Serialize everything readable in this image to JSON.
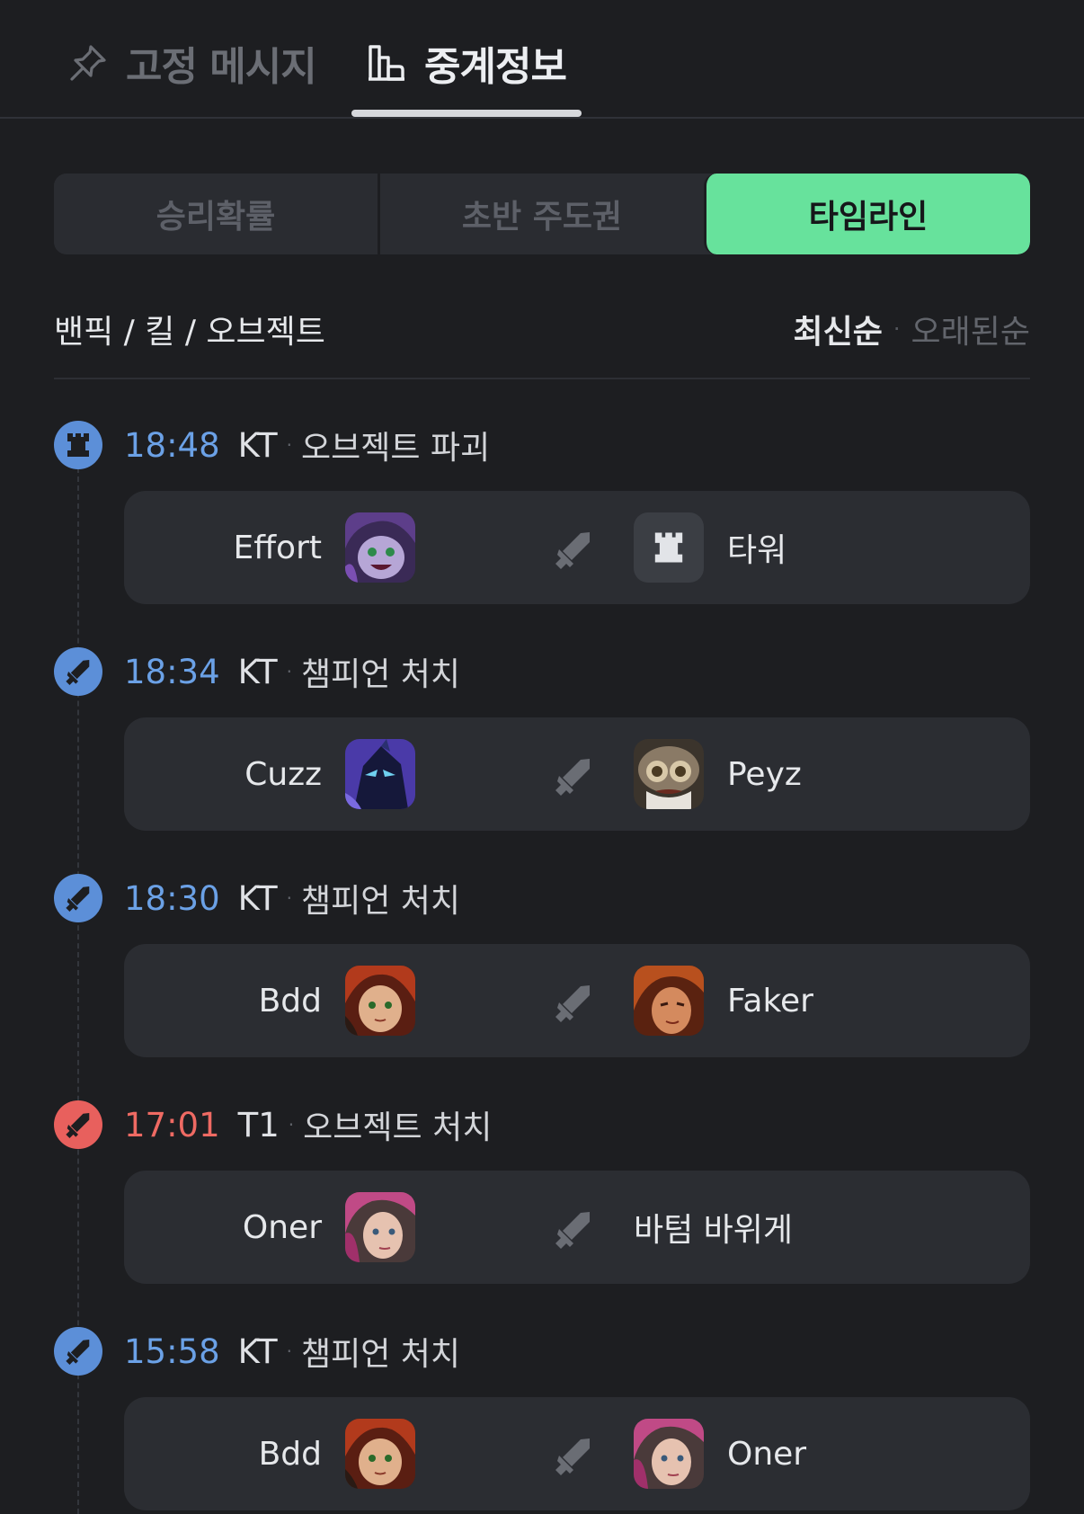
{
  "top_tabs": [
    {
      "label": "고정 메시지",
      "icon": "pin-icon",
      "active": false
    },
    {
      "label": "중계정보",
      "icon": "bar-chart-icon",
      "active": true
    }
  ],
  "segments": [
    {
      "label": "승리확률",
      "active": false
    },
    {
      "label": "초반 주도권",
      "active": false
    },
    {
      "label": "타임라인",
      "active": true
    }
  ],
  "filter": {
    "title": "밴픽 / 킬 / 오브젝트",
    "sort_active": "최신순",
    "sort_separator": "·",
    "sort_inactive": "오래된순"
  },
  "colors": {
    "accent_green": "#67e29c",
    "team_blue": "#6ba1e6",
    "team_red": "#ef6a63"
  },
  "events": [
    {
      "time": "18:48",
      "team": "KT",
      "separator": "·",
      "desc": "오브젝트 파괴",
      "team_color": "blue",
      "icon": "tower-icon",
      "left_player": "Effort",
      "left_avatar": "lulu-avatar",
      "right_label": "타워",
      "right_avatar": "tower-tile"
    },
    {
      "time": "18:34",
      "team": "KT",
      "separator": "·",
      "desc": "챔피언 처치",
      "team_color": "blue",
      "icon": "sword-icon",
      "left_player": "Cuzz",
      "left_avatar": "kayn-avatar",
      "right_label": "Peyz",
      "right_avatar": "ziggs-avatar"
    },
    {
      "time": "18:30",
      "team": "KT",
      "separator": "·",
      "desc": "챔피언 처치",
      "team_color": "blue",
      "icon": "sword-icon",
      "left_player": "Bdd",
      "left_avatar": "annie-avatar",
      "right_label": "Faker",
      "right_avatar": "champion-avatar"
    },
    {
      "time": "17:01",
      "team": "T1",
      "separator": "·",
      "desc": "오브젝트 처치",
      "team_color": "red",
      "icon": "sword-icon",
      "left_player": "Oner",
      "left_avatar": "vi-avatar",
      "right_label": "바텀 바위게",
      "right_avatar": ""
    },
    {
      "time": "15:58",
      "team": "KT",
      "separator": "·",
      "desc": "챔피언 처치",
      "team_color": "blue",
      "icon": "sword-icon",
      "left_player": "Bdd",
      "left_avatar": "annie-avatar",
      "right_label": "Oner",
      "right_avatar": "vi-avatar"
    }
  ]
}
